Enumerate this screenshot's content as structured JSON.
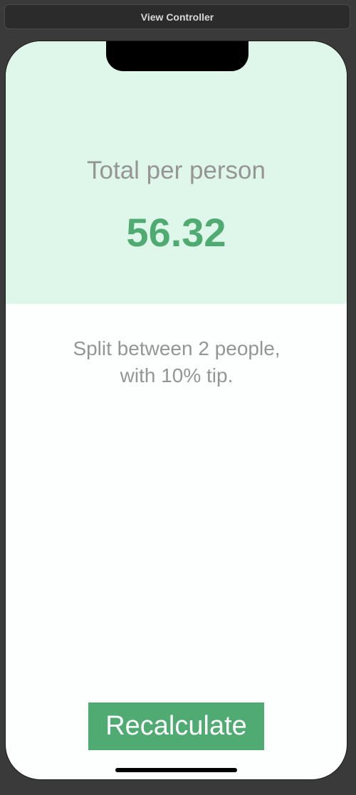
{
  "window": {
    "title": "View Controller"
  },
  "result": {
    "total_label": "Total per person",
    "total_value": "56.32",
    "settings_line1": "Split between 2 people,",
    "settings_line2": "with 10% tip."
  },
  "actions": {
    "recalculate_label": "Recalculate"
  },
  "colors": {
    "top_panel": "#dff7ea",
    "accent": "#4fab72",
    "secondary_text": "#959595",
    "background": "#fdfffe"
  }
}
